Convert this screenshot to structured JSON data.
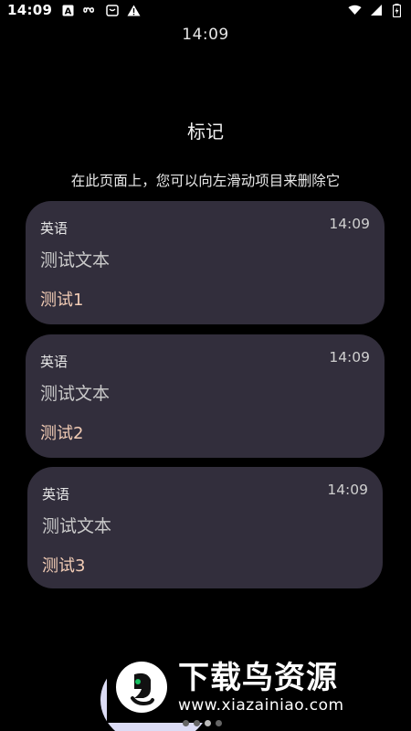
{
  "status_bar": {
    "time": "14:09",
    "left_icons": [
      "a-badge-icon",
      "infinity-icon",
      "sim-card-icon",
      "warning-icon"
    ],
    "right_icons": [
      "wifi-icon",
      "signal-icon",
      "battery-charging-icon"
    ]
  },
  "watch_time": "14:09",
  "page_title": "标记",
  "hint": "在此页面上，您可以向左滑动项目来删除它",
  "cards": [
    {
      "category": "英语",
      "time": "14:09",
      "body": "测试文本",
      "title": "测试1"
    },
    {
      "category": "英语",
      "time": "14:09",
      "body": "测试文本",
      "title": "测试2"
    },
    {
      "category": "英语",
      "time": "14:09",
      "body": "测试文本",
      "title": "测试3"
    }
  ],
  "watermark": {
    "brand": "下载鸟资源",
    "url": "www.xiazainiao.com"
  },
  "colors": {
    "background": "#000000",
    "card_background": "#322e3c",
    "title_accent": "#f3cdb6"
  }
}
